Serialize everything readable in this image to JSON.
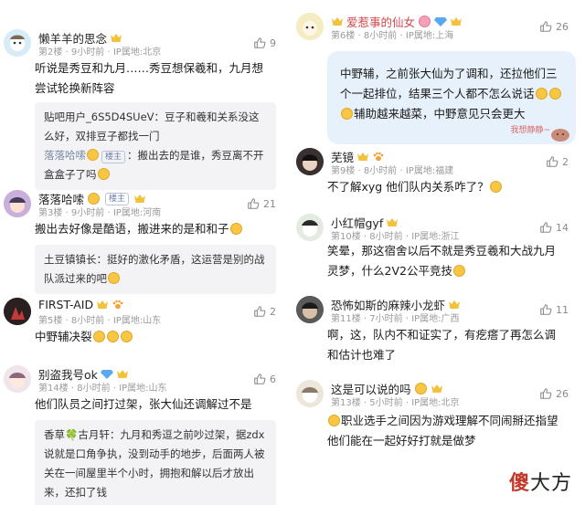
{
  "left": {
    "c1": {
      "name": "懒羊羊的思念",
      "floor": "第2楼",
      "time": "9小时前",
      "ip": "IP属地:北京",
      "likes": "9",
      "text": "听说是秀豆和九月……秀豆想保羲和，九月想尝试轮换新阵容",
      "reply1": "贴吧用户_6S5D4SUeV：豆子和羲和关系没这么好，双排豆子都找一门",
      "reply2_name": "落落哈嗦",
      "reply2_tag": "楼主",
      "reply2_text": "：搬出去的是谁，秀豆离不开盒盒子了吗"
    },
    "c2": {
      "name": "落落哈嗦",
      "tag": "楼主",
      "floor": "第3楼",
      "time": "9小时前",
      "ip": "IP属地:河南",
      "likes": "21",
      "text": "搬出去好像是酷语，搬进来的是和和子",
      "reply": "土豆镇镇长：挺好的激化矛盾，这运营是别的战队派过来的吧"
    },
    "c3": {
      "name": "FIRST-AID",
      "floor": "第5楼",
      "time": "8小时前",
      "ip": "IP属地:山东",
      "likes": "2",
      "text": "中野辅决裂"
    },
    "c4": {
      "name": "别盗我号ok",
      "floor": "第14楼",
      "time": "8小时前",
      "ip": "IP属地:山东",
      "likes": "6",
      "text": "他们队员之间打过架，张大仙还调解过不是",
      "reply": "香草🍀古月轩：九月和秀逗之前吵过架，据zdx说就是口角争执，没到动手的地步，后面两人被关在一间屋里半个小时，拥抱和解以后才放出来，还扣了钱"
    }
  },
  "right": {
    "c1": {
      "name": "爱惹事的仙女",
      "floor": "第6楼",
      "time": "8小时前",
      "ip": "IP属地:上海",
      "likes": "26",
      "text": "中野辅，之前张大仙为了调和，还拉他们三个一起排位，结果三个人都不怎么说话",
      "text2": "辅助越来越菜，中野意见只会更大",
      "sticker": "我想静静~"
    },
    "c2": {
      "name": "芜镜",
      "floor": "第9楼",
      "time": "8小时前",
      "ip": "IP属地:福建",
      "likes": "2",
      "text": "不了解xyg 他们队内关系咋了？"
    },
    "c3": {
      "name": "小红帽gyf",
      "floor": "第10楼",
      "time": "8小时前",
      "ip": "IP属地:浙江",
      "likes": "14",
      "text": "笑晕，那这宿舍以后不就是秀豆羲和大战九月灵梦，什么2V2公平竞技"
    },
    "c4": {
      "name": "恐怖如斯的麻辣小龙虾",
      "floor": "第11楼",
      "time": "7小时前",
      "ip": "IP属地:广西",
      "likes": "11",
      "text": "啊，这，队内不和证实了，有疙瘩了再怎么调和估计也难了"
    },
    "c5": {
      "name": "这是可以说的吗",
      "floor": "第13楼",
      "time": "5小时前",
      "ip": "IP属地:北京",
      "likes": "26",
      "text": "职业选手之间因为游戏理解不同闹掰还指望他们能在一起好好打就是做梦"
    }
  },
  "watermark": {
    "a": "傻",
    "b": "大方"
  },
  "colors": {
    "accent": "#7a8aa5",
    "bubble": "#e7f1fb",
    "reply_bg": "#f3f3f5"
  }
}
